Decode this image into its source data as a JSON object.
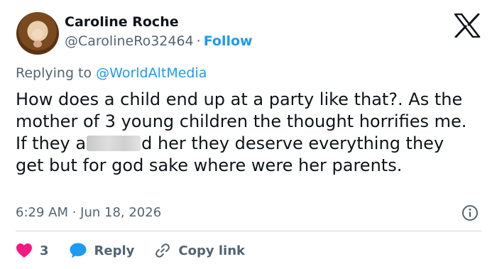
{
  "author": {
    "name": "Caroline Roche",
    "handle": "@CarolineRo32464",
    "separator": "·",
    "follow_label": "Follow"
  },
  "reply_context": {
    "prefix": "Replying to",
    "mention": "@WorldAltMedia"
  },
  "tweet": {
    "text_before_redaction": "How does a child end up at a party like that?. As the mother of 3 young children the thought horrifies me. If they a",
    "text_after_redaction": "d her they deserve everything they get but for god sake where were her parents."
  },
  "meta": {
    "timestamp": "6:29 AM · Jun 18, 2026"
  },
  "actions": {
    "like_count": "3",
    "reply_label": "Reply",
    "copy_link_label": "Copy link"
  },
  "colors": {
    "accent": "#1d9bf0",
    "like": "#f91880",
    "muted": "#536471",
    "text": "#0f1419"
  },
  "icons": {
    "brand": "x-logo-icon",
    "info": "info-icon",
    "like": "heart-icon",
    "reply": "speech-bubble-icon",
    "copy": "link-icon"
  }
}
